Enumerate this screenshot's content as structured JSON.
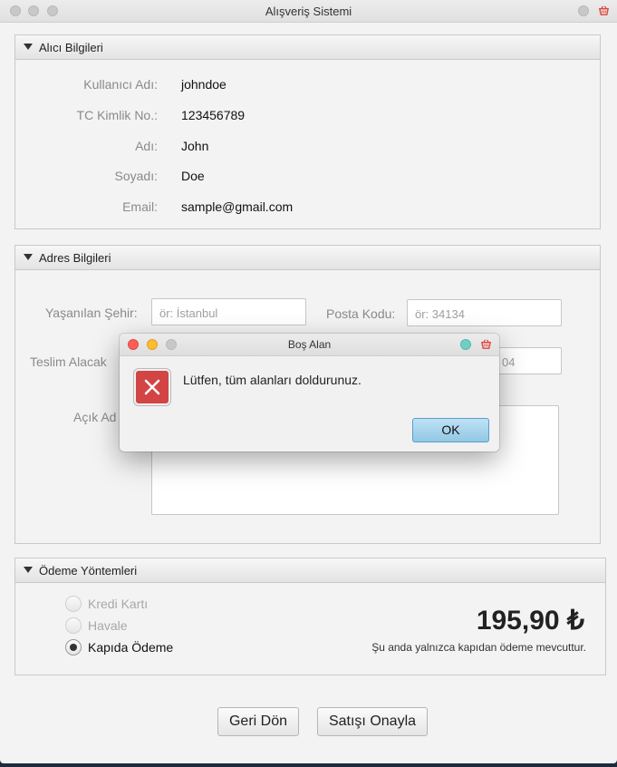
{
  "window": {
    "title": "Alışveriş Sistemi"
  },
  "buyer": {
    "title": "Alıcı Bilgileri",
    "fields": [
      {
        "label": "Kullanıcı Adı:",
        "value": "johndoe"
      },
      {
        "label": "TC Kimlik No.:",
        "value": "123456789"
      },
      {
        "label": "Adı:",
        "value": "John"
      },
      {
        "label": "Soyadı:",
        "value": "Doe"
      },
      {
        "label": "Email:",
        "value": "sample@gmail.com"
      }
    ]
  },
  "address": {
    "title": "Adres Bilgileri",
    "city_label": "Yaşanılan Şehir:",
    "city_placeholder": "ör: İstanbul",
    "postal_label": "Posta Kodu:",
    "postal_placeholder": "ör: 34134",
    "recipient_label": "Teslim Alacak",
    "phone_placeholder_partial": "04",
    "open_address_label": "Açık Ad"
  },
  "payment": {
    "title": "Ödeme Yöntemleri",
    "options": [
      {
        "label": "Kredi Kartı",
        "enabled": false,
        "selected": false
      },
      {
        "label": "Havale",
        "enabled": false,
        "selected": false
      },
      {
        "label": "Kapıda Ödeme",
        "enabled": true,
        "selected": true
      }
    ],
    "price": "195,90 ₺",
    "note": "Şu anda yalnızca kapıdan ödeme mevcuttur."
  },
  "buttons": {
    "back": "Geri Dön",
    "confirm": "Satışı Onayla"
  },
  "dialog": {
    "title": "Boş Alan",
    "message": "Lütfen, tüm alanları doldurunuz.",
    "ok": "OK"
  },
  "colors": {
    "error_icon": "#d34444",
    "ok_button": "#a8d5ee",
    "close_red": "#fc5f57",
    "minimize_yellow": "#fdbc2e",
    "teal_dot": "#6fcfc4"
  },
  "icons": {
    "titlebar_right": [
      "circle-icon",
      "shopping-basket-icon"
    ],
    "dialog": "error-x-icon"
  }
}
